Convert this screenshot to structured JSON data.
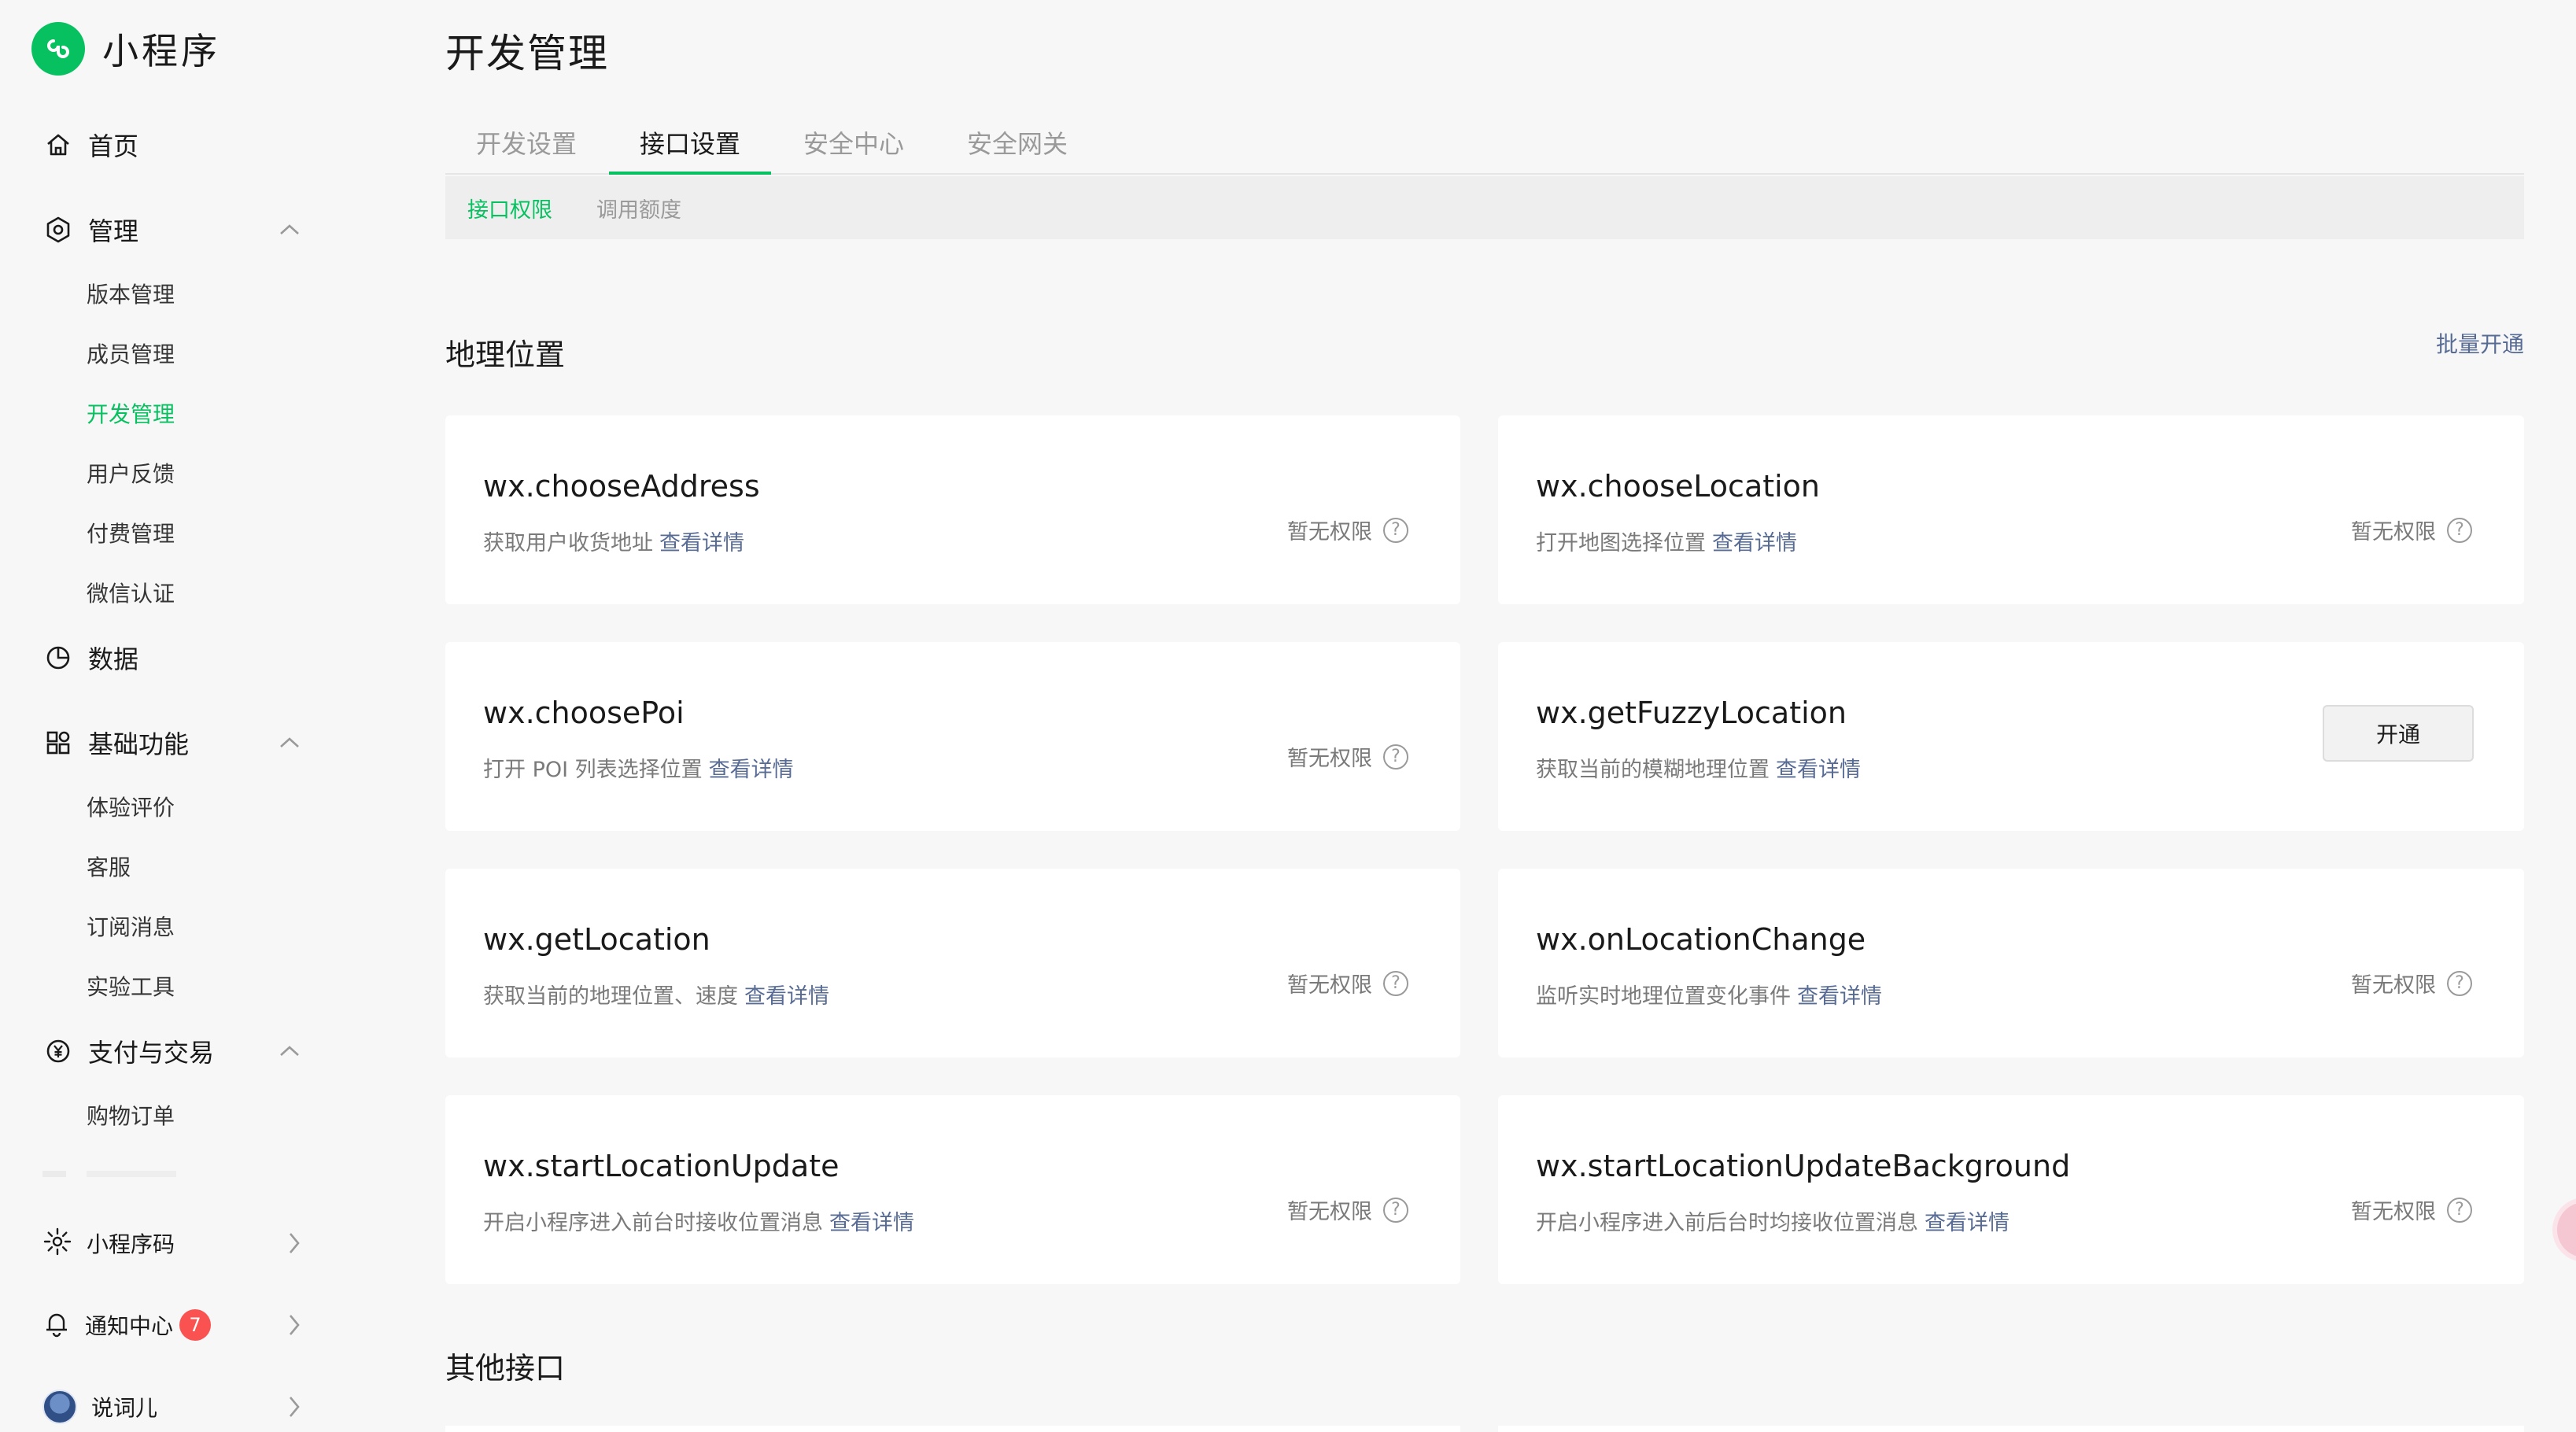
{
  "app": {
    "name": "小程序"
  },
  "sidebar": {
    "home": "首页",
    "groups": [
      {
        "label": "管理",
        "items": [
          "版本管理",
          "成员管理",
          "开发管理",
          "用户反馈",
          "付费管理",
          "微信认证"
        ],
        "active": "开发管理"
      },
      {
        "label": "数据"
      },
      {
        "label": "基础功能",
        "items": [
          "体验评价",
          "客服",
          "订阅消息",
          "实验工具"
        ]
      },
      {
        "label": "支付与交易",
        "items": [
          "购物订单"
        ]
      }
    ],
    "bottom": {
      "qrcode": "小程序码",
      "notifications": "通知中心",
      "notification_count": "7",
      "user": "说词儿"
    }
  },
  "page": {
    "title": "开发管理"
  },
  "tabs": [
    "开发设置",
    "接口设置",
    "安全中心",
    "安全网关"
  ],
  "active_tab": "接口设置",
  "subtabs": [
    "接口权限",
    "调用额度"
  ],
  "active_subtab": "接口权限",
  "sections": {
    "location": {
      "title": "地理位置",
      "bulk_action": "批量开通"
    },
    "other": {
      "title": "其他接口"
    }
  },
  "detail_link": "查看详情",
  "status_none": "暂无权限",
  "enable_label": "开通",
  "apis": [
    {
      "name": "wx.chooseAddress",
      "desc": "获取用户收货地址",
      "state": "none"
    },
    {
      "name": "wx.chooseLocation",
      "desc": "打开地图选择位置",
      "state": "none"
    },
    {
      "name": "wx.choosePoi",
      "desc": "打开 POI 列表选择位置",
      "state": "none"
    },
    {
      "name": "wx.getFuzzyLocation",
      "desc": "获取当前的模糊地理位置",
      "state": "enable"
    },
    {
      "name": "wx.getLocation",
      "desc": "获取当前的地理位置、速度",
      "state": "none"
    },
    {
      "name": "wx.onLocationChange",
      "desc": "监听实时地理位置变化事件",
      "state": "none"
    },
    {
      "name": "wx.startLocationUpdate",
      "desc": "开启小程序进入前台时接收位置消息",
      "state": "none"
    },
    {
      "name": "wx.startLocationUpdateBackground",
      "desc": "开启小程序进入前后台时均接收位置消息",
      "state": "none"
    }
  ],
  "colors": {
    "brand": "#07c160",
    "link": "#576b95",
    "badge": "#fa5151"
  }
}
